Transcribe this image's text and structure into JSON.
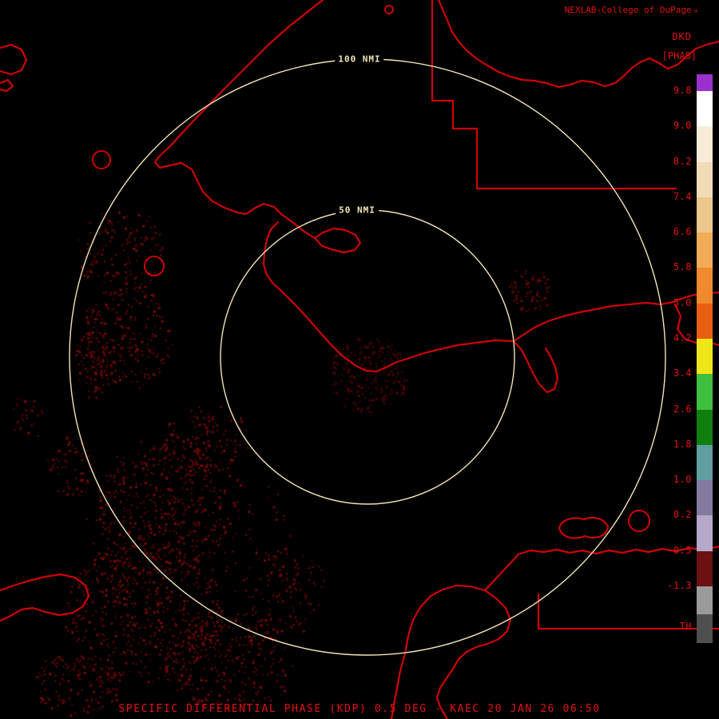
{
  "header": {
    "title": "NEXLAB-College of DuPage",
    "logo_glyph": "✳",
    "product_code": "DKD",
    "product_units": "[PHAS]"
  },
  "rings": [
    {
      "label": "100 NMI"
    },
    {
      "label": "50 NMI"
    }
  ],
  "colorbar": {
    "ticks": [
      "9.8",
      "9.0",
      "8.2",
      "7.4",
      "6.6",
      "5.8",
      "5.0",
      "4.2",
      "3.4",
      "2.6",
      "1.8",
      "1.0",
      "0.2",
      "-0.5",
      "-1.3"
    ],
    "threshold_label": "TH",
    "colors": [
      "#9A30CE",
      "#FFFFFF",
      "#F6ECD8",
      "#F0DDB6",
      "#EDC88C",
      "#F2AC58",
      "#F08A2E",
      "#E85E12",
      "#EFE61A",
      "#3FBF3F",
      "#0F7F0F",
      "#5F9EA0",
      "#837AA0",
      "#B5A8C8",
      "#6B1111",
      "#9A9A9A",
      "#4F4F4F"
    ]
  },
  "footer": {
    "caption": "SPECIFIC DIFFERENTIAL PHASE (KDP) 0.5 DEG - KAEC 20 JAN 26 06:50"
  },
  "colors": {
    "background": "#000000",
    "map_outline": "#CE0202",
    "text_red": "#E21212",
    "range_ring": "#F2E4B6",
    "echo_shades": [
      "#4A0404",
      "#5C0606",
      "#6C0707",
      "#7C0909"
    ],
    "echo_dim_shades": [
      "#300202",
      "#420404",
      "#520505"
    ]
  }
}
